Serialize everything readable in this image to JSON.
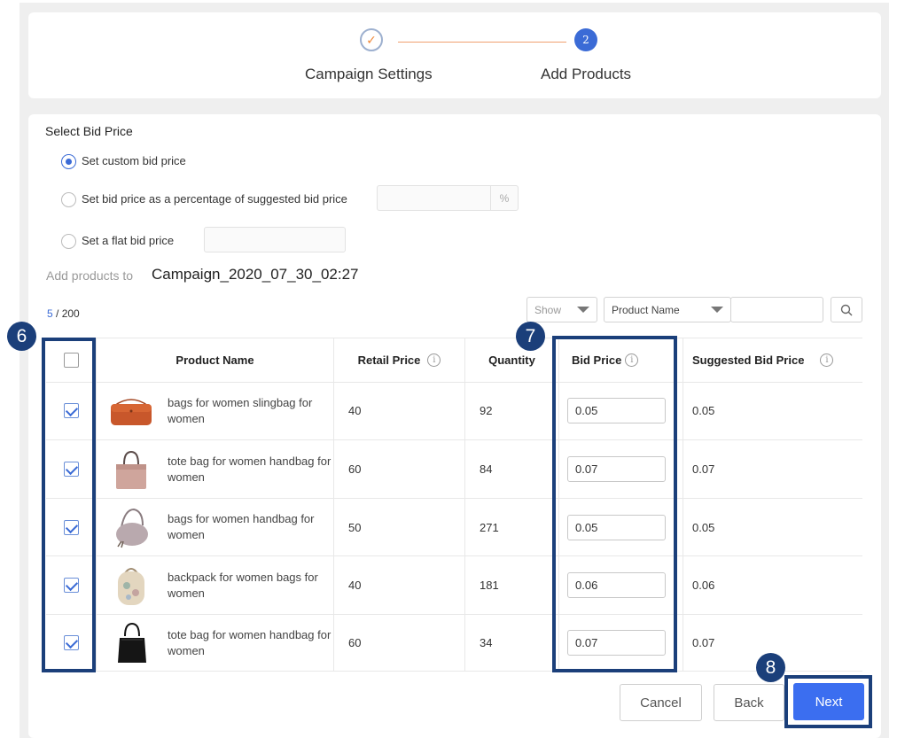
{
  "steps": [
    {
      "label": "Campaign Settings",
      "marker": "✓"
    },
    {
      "label": "Add Products",
      "marker": "2"
    }
  ],
  "bid": {
    "section_title": "Select Bid Price",
    "options": [
      {
        "label": "Set custom bid price",
        "selected": true
      },
      {
        "label": "Set bid price as a percentage of suggested bid price",
        "selected": false,
        "suffix": "%"
      },
      {
        "label": "Set a flat bid price",
        "selected": false
      }
    ]
  },
  "campaign": {
    "prefix": "Add products to",
    "name": "Campaign_2020_07_30_02:27"
  },
  "count": {
    "selected": "5",
    "total": " / 200"
  },
  "filters": {
    "show": "Show",
    "field": "Product Name",
    "search_value": ""
  },
  "table": {
    "headers": {
      "product_name": "Product Name",
      "retail_price": "Retail Price",
      "quantity": "Quantity",
      "bid_price": "Bid Price",
      "suggested_bid_price": "Suggested Bid Price",
      "info_glyph": "i"
    },
    "rows": [
      {
        "name": "bags for women slingbag for women",
        "retail": "40",
        "qty": "92",
        "bid": "0.05",
        "suggested": "0.05",
        "image": "orange-slingbag",
        "checked": true
      },
      {
        "name": "tote bag for women handbag for women",
        "retail": "60",
        "qty": "84",
        "bid": "0.07",
        "suggested": "0.07",
        "image": "pink-tote",
        "checked": true
      },
      {
        "name": "bags for women handbag for women",
        "retail": "50",
        "qty": "271",
        "bid": "0.05",
        "suggested": "0.05",
        "image": "grey-hobo",
        "checked": true
      },
      {
        "name": "backpack for women bags for women",
        "retail": "40",
        "qty": "181",
        "bid": "0.06",
        "suggested": "0.06",
        "image": "floral-backpack",
        "checked": true
      },
      {
        "name": "tote bag for women handbag for women",
        "retail": "60",
        "qty": "34",
        "bid": "0.07",
        "suggested": "0.07",
        "image": "black-bucket-bag",
        "checked": true
      }
    ]
  },
  "buttons": {
    "cancel": "Cancel",
    "back": "Back",
    "next": "Next"
  },
  "callouts": {
    "checkbox_column": "6",
    "bid_column": "7",
    "next_button": "8"
  },
  "colors": {
    "accent": "#3b6ef0",
    "callout": "#1b3f7a",
    "step_done": "#f08a3c"
  }
}
